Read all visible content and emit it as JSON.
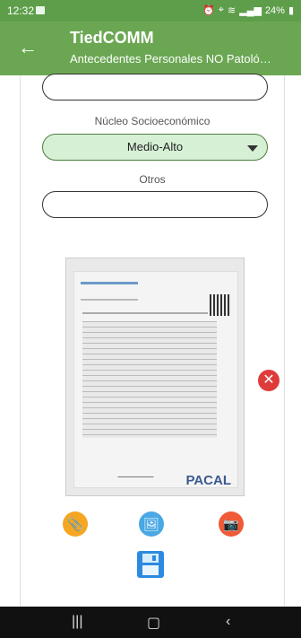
{
  "status_bar": {
    "time": "12:32",
    "battery": "24%"
  },
  "app_bar": {
    "title": "TiedCOMM",
    "subtitle": "Antecedentes Personales NO Patoló…"
  },
  "form": {
    "socioeconomic_label": "Núcleo Socioeconómico",
    "socioeconomic_value": "Medio-Alto",
    "otros_label": "Otros",
    "otros_value": ""
  },
  "document_image": {
    "watermark": "PACAL"
  },
  "icons": {
    "attach": "paperclip-icon",
    "gallery": "image-icon",
    "camera": "camera-icon",
    "save": "save-icon",
    "delete": "close-icon"
  },
  "colors": {
    "app_bar": "#6ba753",
    "select_bg": "#d6f0d6",
    "delete": "#e03b3b",
    "attach": "#f5a623",
    "gallery": "#4aa8e4",
    "camera": "#f05a36",
    "save": "#2c8be0"
  }
}
